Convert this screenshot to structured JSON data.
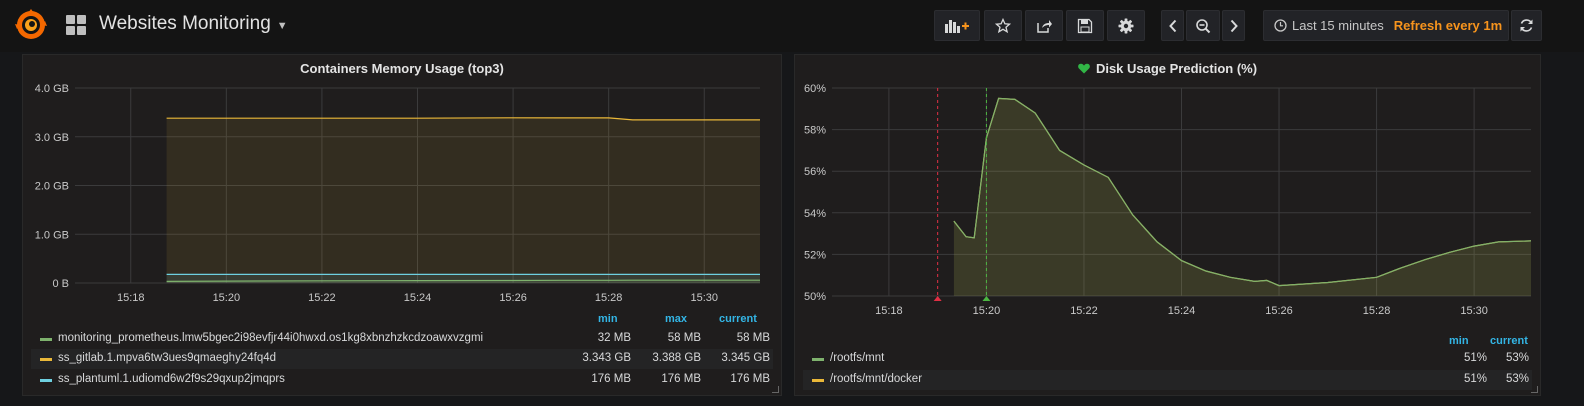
{
  "nav": {
    "dashboard_title": "Websites Monitoring",
    "time_range": "Last 15 minutes",
    "refresh": "Refresh every 1m"
  },
  "panels": {
    "memory": {
      "title": "Containers Memory Usage (top3)",
      "legend_headers": {
        "min": "min",
        "max": "max",
        "current": "current"
      },
      "legend": [
        {
          "name": "monitoring_prometheus.lmw5bgec2i98evfjr44i0hwxd.os1kg8xbnzhzkcdzoawxvzgmi",
          "min": "32 MB",
          "max": "58 MB",
          "current": "58 MB",
          "color": "#7eb26d"
        },
        {
          "name": "ss_gitlab.1.mpva6tw3ues9qmaeghy24fq4d",
          "min": "3.343 GB",
          "max": "3.388 GB",
          "current": "3.345 GB",
          "color": "#eab839"
        },
        {
          "name": "ss_plantuml.1.udiomd6w2f9s29qxup2jmqprs",
          "min": "176 MB",
          "max": "176 MB",
          "current": "176 MB",
          "color": "#6ed0e0"
        }
      ]
    },
    "disk": {
      "title": "Disk Usage Prediction (%)",
      "legend_headers": {
        "min": "min",
        "current": "current"
      },
      "legend": [
        {
          "name": "/rootfs/mnt",
          "min": "51%",
          "current": "53%",
          "color": "#7eb26d"
        },
        {
          "name": "/rootfs/mnt/docker",
          "min": "51%",
          "current": "53%",
          "color": "#eab839"
        }
      ]
    }
  },
  "chart_data": [
    {
      "type": "area",
      "title": "Containers Memory Usage (top3)",
      "x_ticks": [
        "15:18",
        "15:20",
        "15:22",
        "15:24",
        "15:26",
        "15:28",
        "15:30"
      ],
      "y_ticks": [
        "0 B",
        "1.0 GB",
        "2.0 GB",
        "3.0 GB",
        "4.0 GB"
      ],
      "ylim": [
        0,
        4.0
      ],
      "xlim": [
        "15:16:50",
        "15:31:10"
      ],
      "x": [
        "15:18:45",
        "15:20",
        "15:22",
        "15:24",
        "15:26",
        "15:27",
        "15:28",
        "15:28:30",
        "15:30",
        "15:31:10"
      ],
      "series": [
        {
          "name": "ss_gitlab.1.mpva6tw3ues9qmaeghy24fq4d",
          "values": [
            3.38,
            3.38,
            3.38,
            3.38,
            3.388,
            3.387,
            3.386,
            3.345,
            3.345,
            3.345
          ]
        },
        {
          "name": "ss_plantuml.1.udiomd6w2f9s29qxup2jmqprs",
          "values": [
            0.176,
            0.176,
            0.176,
            0.176,
            0.176,
            0.176,
            0.176,
            0.176,
            0.176,
            0.176
          ]
        },
        {
          "name": "monitoring_prometheus.lmw5bgec2i98evfjr44i0hwxd.os1kg8xbnzhzkcdzoawxvzgmi",
          "values": [
            0.032,
            0.04,
            0.045,
            0.05,
            0.052,
            0.055,
            0.056,
            0.057,
            0.058,
            0.058
          ]
        }
      ],
      "grid": true,
      "legend_placement": "bottom"
    },
    {
      "type": "area",
      "title": "Disk Usage Prediction (%)",
      "x_ticks": [
        "15:18",
        "15:20",
        "15:22",
        "15:24",
        "15:26",
        "15:28",
        "15:30"
      ],
      "y_ticks": [
        "50%",
        "52%",
        "54%",
        "56%",
        "58%",
        "60%"
      ],
      "ylim": [
        50,
        60
      ],
      "xlim": [
        "15:16:50",
        "15:31:10"
      ],
      "series": [
        {
          "name": "/rootfs/mnt/docker",
          "x": [
            "15:19:20",
            "15:19:35",
            "15:19:45",
            "15:20",
            "15:20:15",
            "15:20:35",
            "15:21",
            "15:21:30",
            "15:22",
            "15:22:30",
            "15:23",
            "15:23:30",
            "15:24",
            "15:24:30",
            "15:25",
            "15:25:30",
            "15:25:45",
            "15:26",
            "15:27",
            "15:28",
            "15:28:30",
            "15:29",
            "15:29:30",
            "15:30",
            "15:30:30",
            "15:31:10"
          ],
          "values": [
            53.6,
            52.85,
            52.8,
            57.6,
            59.5,
            59.45,
            58.8,
            57.0,
            56.3,
            55.7,
            53.9,
            52.6,
            51.7,
            51.2,
            50.9,
            50.7,
            50.75,
            50.5,
            50.65,
            50.9,
            51.35,
            51.75,
            52.1,
            52.4,
            52.6,
            52.65
          ]
        },
        {
          "name": "/rootfs/mnt",
          "x": [
            "15:19:20",
            "15:19:35",
            "15:19:45",
            "15:20",
            "15:20:15",
            "15:20:35",
            "15:21",
            "15:21:30",
            "15:22",
            "15:22:30",
            "15:23",
            "15:23:30",
            "15:24",
            "15:24:30",
            "15:25",
            "15:25:30",
            "15:25:45",
            "15:26",
            "15:27",
            "15:28",
            "15:28:30",
            "15:29",
            "15:29:30",
            "15:30",
            "15:30:30",
            "15:31:10"
          ],
          "values": [
            53.6,
            52.85,
            52.8,
            57.6,
            59.5,
            59.45,
            58.8,
            57.0,
            56.3,
            55.7,
            53.9,
            52.6,
            51.7,
            51.2,
            50.9,
            50.7,
            50.75,
            50.5,
            50.65,
            50.9,
            51.35,
            51.75,
            52.1,
            52.4,
            52.6,
            52.65
          ]
        }
      ],
      "annotations": [
        {
          "time": "15:19",
          "color": "#e02f44"
        },
        {
          "time": "15:20",
          "color": "#4cb642"
        }
      ],
      "grid": true,
      "legend_placement": "bottom"
    }
  ]
}
